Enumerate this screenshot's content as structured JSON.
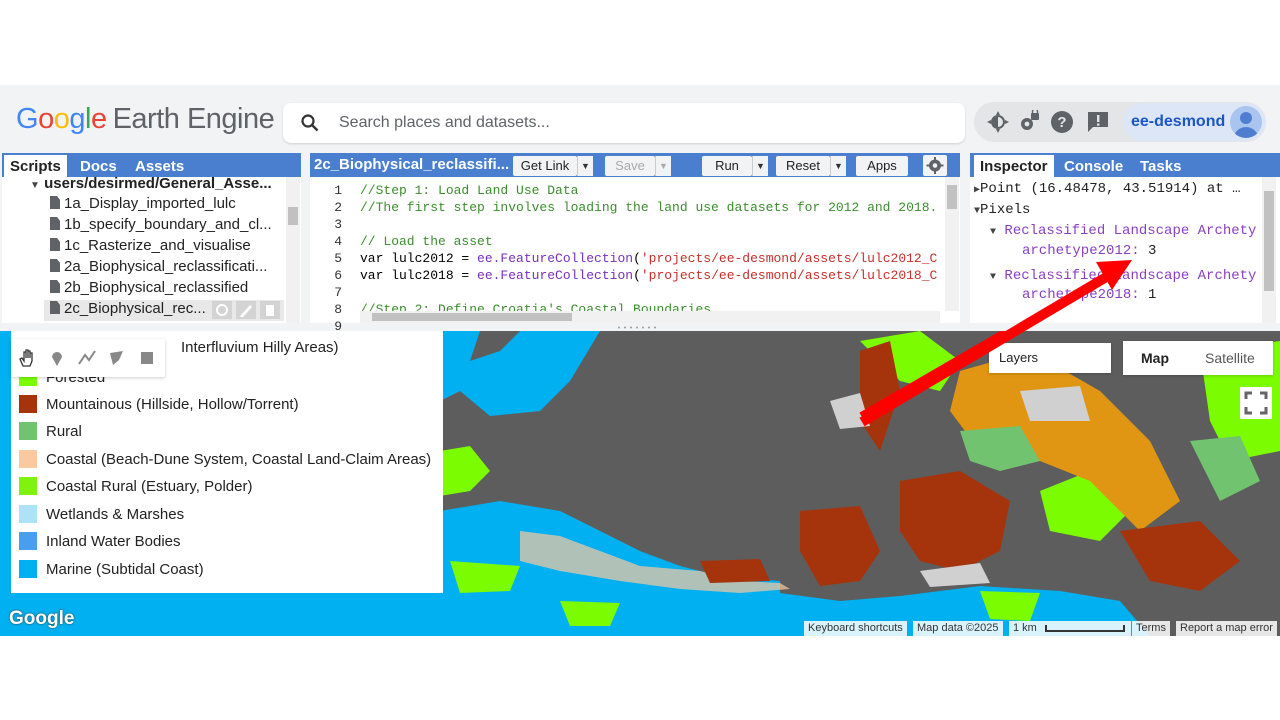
{
  "header": {
    "logo_google": [
      "G",
      "o",
      "o",
      "g",
      "l",
      "e"
    ],
    "logo_rest": "Earth Engine",
    "search_placeholder": "Search places and datasets...",
    "user": "ee-desmond"
  },
  "scripts_panel": {
    "tabs": [
      "Scripts",
      "Docs",
      "Assets"
    ],
    "folder": "users/desirmed/General_Asse...",
    "files": [
      "1a_Display_imported_lulc",
      "1b_specify_boundary_and_cl...",
      "1c_Rasterize_and_visualise",
      "2a_Biophysical_reclassificati...",
      "2b_Biophysical_reclassified",
      "2c_Biophysical_rec..."
    ]
  },
  "code_panel": {
    "filename": "2c_Biophysical_reclassifi...",
    "buttons": {
      "get_link": "Get Link",
      "save": "Save",
      "run": "Run",
      "reset": "Reset",
      "apps": "Apps"
    },
    "line_numbers": [
      "1",
      "2",
      "3",
      "4",
      "5",
      "6",
      "7",
      "8",
      "9"
    ],
    "lines": [
      {
        "c": "//Step 1: Load Land Use Data"
      },
      {
        "c": "//The first step involves loading the land use datasets for 2012 and 2018."
      },
      {
        "c": ""
      },
      {
        "c": "// Load the asset"
      },
      {
        "v": "var lulc2012 = ",
        "f": "ee.FeatureCollection",
        "p": "(",
        "s": "'projects/ee-desmond/assets/lulc2012_C"
      },
      {
        "v": "var lulc2018 = ",
        "f": "ee.FeatureCollection",
        "p": "(",
        "s": "'projects/ee-desmond/assets/lulc2018_C"
      },
      {
        "c": ""
      },
      {
        "c": "//Step 2: Define Croatia's Coastal Boundaries"
      }
    ]
  },
  "right_panel": {
    "tabs": [
      "Inspector",
      "Console",
      "Tasks"
    ],
    "point": "Point (16.48478, 43.51914) at …",
    "pixels": "Pixels",
    "layer1": "Reclassified Landscape Archety",
    "prop1_key": "archetype2012",
    "prop1_val": "3",
    "layer2": "Reclassified Landscape Archety",
    "prop2_key": "archetype2018",
    "prop2_val": "1"
  },
  "legend": {
    "items": [
      {
        "label": "Interfluvium Hilly Areas)",
        "color": "#e6a817"
      },
      {
        "label": "Forested",
        "color": "#7cfc00"
      },
      {
        "label": "Mountainous (Hillside, Hollow/Torrent)",
        "color": "#a5340c"
      },
      {
        "label": "Rural",
        "color": "#72c36f"
      },
      {
        "label": "Coastal (Beach-Dune System, Coastal Land-Claim Areas)",
        "color": "#fbc99f"
      },
      {
        "label": "Coastal Rural (Estuary, Polder)",
        "color": "#80f20f"
      },
      {
        "label": "Wetlands & Marshes",
        "color": "#aee3f7"
      },
      {
        "label": "Inland Water Bodies",
        "color": "#4a9eef"
      },
      {
        "label": "Marine (Subtidal Coast)",
        "color": "#00b0f0"
      }
    ]
  },
  "map": {
    "layers": "Layers",
    "map_type": "Map",
    "satellite": "Satellite",
    "footer": {
      "shortcuts": "Keyboard shortcuts",
      "mapdata": "Map data ©2025",
      "scale": "1 km",
      "terms": "Terms",
      "report": "Report a map error"
    },
    "google": "Google",
    "colors": {
      "urban": "#5d5d5d",
      "sea": "#00b0f0",
      "forest": "#7cfc00",
      "mountain": "#a5340c",
      "hilly": "#e09612",
      "rural": "#72c36f",
      "bare": "#d0d0d0",
      "arrow": "#ff0000"
    }
  }
}
